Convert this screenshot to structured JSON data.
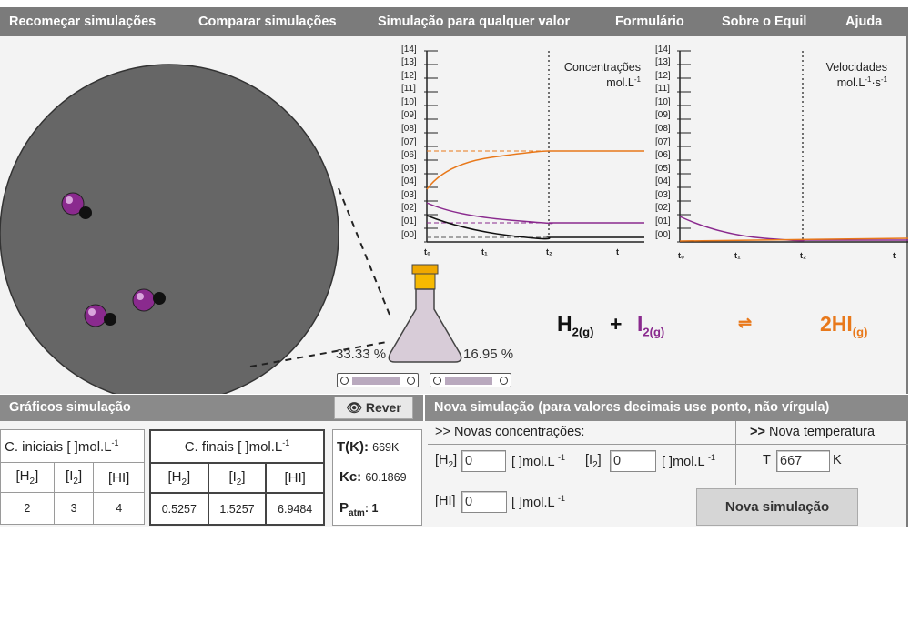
{
  "menu": {
    "items": [
      "Recomeçar simulações",
      "Comparar simulações",
      "Simulação para qualquer valor",
      "Formulário",
      "Sobre o Equil",
      "Ajuda"
    ]
  },
  "flask": {
    "left_percent": "33.33 %",
    "right_percent": "16.95 %"
  },
  "plots": {
    "conc_title": "Concentrações",
    "conc_unit": "mol.L",
    "conc_unit_exp": "-1",
    "vel_title": "Velocidades",
    "vel_unit": "mol.L",
    "vel_unit_exp1": "-1",
    "vel_unit_mid": "·s",
    "vel_unit_exp2": "-1",
    "y_ticks": [
      "[14]",
      "[13]",
      "[12]",
      "[11]",
      "[10]",
      "[09]",
      "[08]",
      "[07]",
      "[06]",
      "[05]",
      "[04]",
      "[03]",
      "[02]",
      "[01]",
      "[00]"
    ],
    "x_ticks": [
      "t₀",
      "t₁",
      "t₂",
      "t"
    ]
  },
  "equation": {
    "h2": "H",
    "h2_sub": "2(g)",
    "plus": "+",
    "i2": "I",
    "i2_sub": "2(g)",
    "arrow": "⇌",
    "hi": "2HI",
    "hi_sub": "(g)"
  },
  "colors": {
    "h2": "#111111",
    "i2": "#8a2a8e",
    "hi": "#e8781a",
    "menu_bg": "#7b7b7b",
    "section_bg": "#8a8a8a",
    "vessel": "#666666"
  },
  "bottom": {
    "graficos_label": "Gráficos simulação",
    "rever_label": "Rever",
    "nova_header": "Nova simulação (para valores decimais use ponto, não vírgula)",
    "iniciais_title": "C. iniciais [ ]mol.L",
    "finais_title": "C. finais [ ]mol.L",
    "unit_exp": "-1",
    "col_h2": "[H",
    "col_i2": "[I",
    "col_hi": "[HI]",
    "sub2": "2",
    "br": "]",
    "iniciais_values": [
      "2",
      "3",
      "4"
    ],
    "finais_values": [
      "0.5257",
      "1.5257",
      "6.9484"
    ],
    "tk_label": "T(K):",
    "tk_value": "669K",
    "kc_label": "Kc:",
    "kc_value": "60.1869",
    "patm_label": "P",
    "patm_sub": "atm",
    "patm_value": ": 1",
    "novas_conc": ">> Novas concentrações:",
    "nova_temp_arrows": ">>",
    "nova_temp": " Nova temperatura",
    "h2_label": "[H",
    "h2_label_end": "]",
    "unit_label": "[ ]mol.L",
    "i2_label": "[I",
    "hi_label": "[HI]",
    "h2_input": "0",
    "i2_input": "0",
    "hi_input": "0",
    "t_label": "T",
    "t_input": "667",
    "k_label": "K",
    "nova_button": "Nova simulação"
  }
}
